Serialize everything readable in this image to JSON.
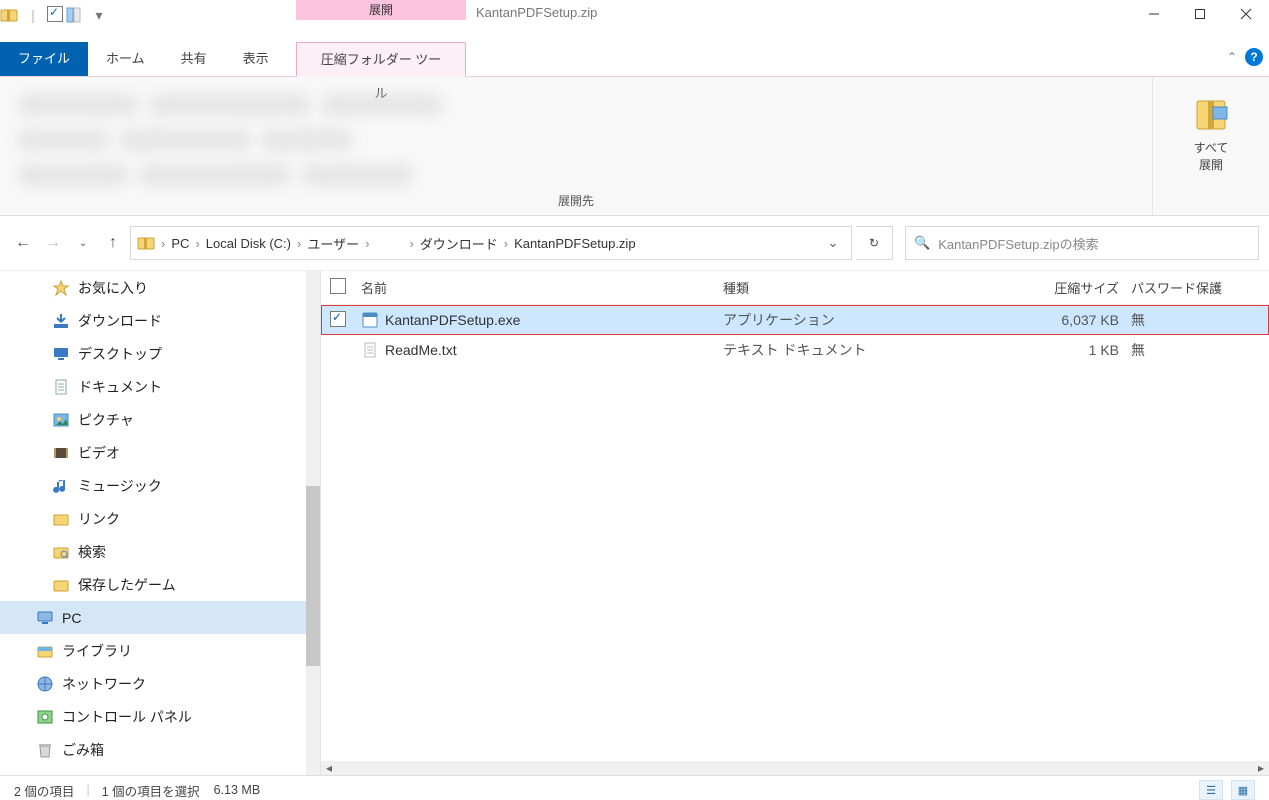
{
  "title": "KantanPDFSetup.zip",
  "contextual_header": "展開",
  "ribbon": {
    "tabs": {
      "file": "ファイル",
      "home": "ホーム",
      "share": "共有",
      "view": "表示",
      "context": "圧縮フォルダー ツール"
    },
    "left_group_caption": "展開先",
    "extract_all_l1": "すべて",
    "extract_all_l2": "展開"
  },
  "nav": {
    "crumbs": [
      "PC",
      "Local Disk (C:)",
      "ユーザー",
      "",
      "ダウンロード",
      "KantanPDFSetup.zip"
    ],
    "search_placeholder": "KantanPDFSetup.zipの検索"
  },
  "columns": {
    "name": "名前",
    "type": "種類",
    "size": "圧縮サイズ",
    "pwd": "パスワード保護"
  },
  "rows": [
    {
      "checked": true,
      "name": "KantanPDFSetup.exe",
      "type": "アプリケーション",
      "size": "6,037 KB",
      "pwd": "無",
      "selected": true,
      "icon": "exe"
    },
    {
      "checked": false,
      "name": "ReadMe.txt",
      "type": "テキスト ドキュメント",
      "size": "1 KB",
      "pwd": "無",
      "selected": false,
      "icon": "txt"
    }
  ],
  "tree": [
    {
      "label": "お気に入り",
      "icon": "star"
    },
    {
      "label": "ダウンロード",
      "icon": "download"
    },
    {
      "label": "デスクトップ",
      "icon": "desktop"
    },
    {
      "label": "ドキュメント",
      "icon": "doc"
    },
    {
      "label": "ピクチャ",
      "icon": "pic"
    },
    {
      "label": "ビデオ",
      "icon": "video"
    },
    {
      "label": "ミュージック",
      "icon": "music"
    },
    {
      "label": "リンク",
      "icon": "link"
    },
    {
      "label": "検索",
      "icon": "search"
    },
    {
      "label": "保存したゲーム",
      "icon": "game"
    },
    {
      "label": "PC",
      "icon": "pc",
      "selected": true,
      "indent": true
    },
    {
      "label": "ライブラリ",
      "icon": "lib",
      "indent": true
    },
    {
      "label": "ネットワーク",
      "icon": "net",
      "indent": true
    },
    {
      "label": "コントロール パネル",
      "icon": "cpl",
      "indent": true
    },
    {
      "label": "ごみ箱",
      "icon": "trash",
      "indent": true
    }
  ],
  "status": {
    "count": "2 個の項目",
    "selection": "1 個の項目を選択",
    "size": "6.13 MB"
  }
}
